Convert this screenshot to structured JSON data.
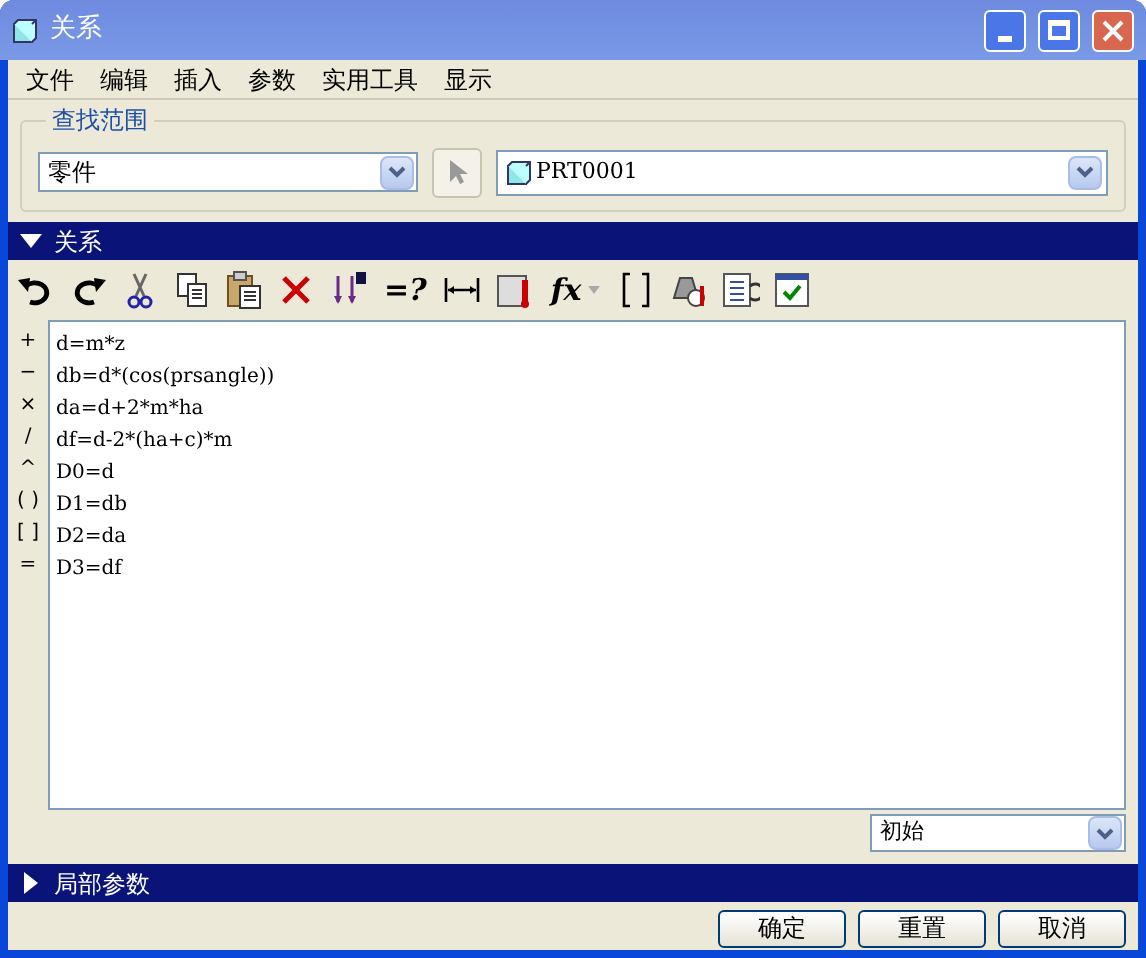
{
  "window": {
    "title": "关系"
  },
  "menu": [
    "文件",
    "编辑",
    "插入",
    "参数",
    "实用工具",
    "显示"
  ],
  "search_scope": {
    "title": "查找范围",
    "type_select": "零件",
    "model_select": "PRT0001"
  },
  "relations_section": {
    "title": "关系",
    "expanded": true
  },
  "toolbar": [
    {
      "kind": "undo"
    },
    {
      "kind": "redo"
    },
    {
      "kind": "cut"
    },
    {
      "kind": "copy"
    },
    {
      "kind": "paste"
    },
    {
      "kind": "delete"
    },
    {
      "kind": "sort"
    },
    {
      "kind": "text",
      "label": "=?"
    },
    {
      "kind": "dimension"
    },
    {
      "kind": "units"
    },
    {
      "kind": "text",
      "label": "fx",
      "dropdown": true
    },
    {
      "kind": "brackets"
    },
    {
      "kind": "mass"
    },
    {
      "kind": "list"
    },
    {
      "kind": "verify"
    }
  ],
  "operators": [
    "+",
    "−",
    "×",
    "/",
    "^",
    "( )",
    "[ ]",
    "="
  ],
  "relations": [
    "d=m*z",
    "db=d*(cos(prsangle))",
    "da=d+2*m*ha",
    "df=d-2*(ha+c)*m",
    "D0=d",
    "D1=db",
    "D2=da",
    "D3=df"
  ],
  "state_select": "初始",
  "local_params_section": {
    "title": "局部参数",
    "expanded": false
  },
  "buttons": [
    "确定",
    "重置",
    "取消"
  ]
}
